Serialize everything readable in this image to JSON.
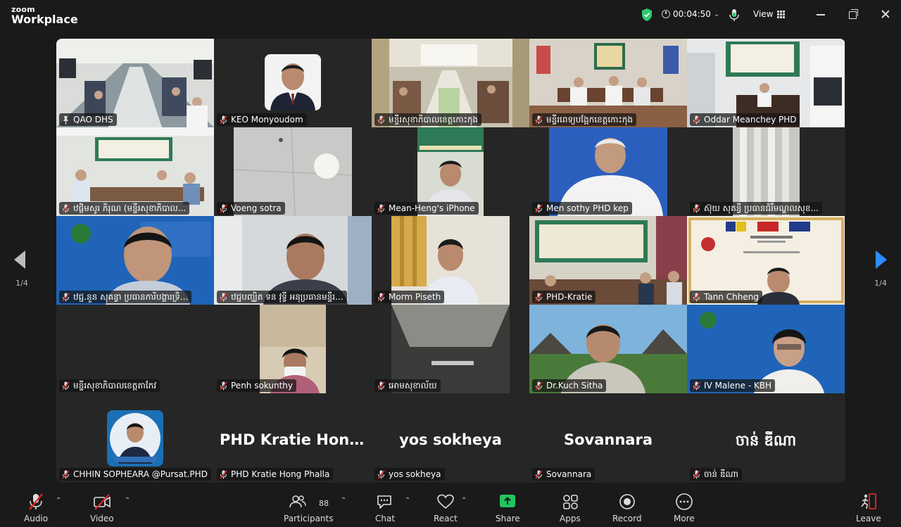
{
  "app": {
    "brand_top": "zoom",
    "brand_bottom": "Workplace"
  },
  "topbar": {
    "timer": "00:04:50",
    "view_label": "View"
  },
  "pagination": {
    "left": "1/4",
    "right": "1/4"
  },
  "tiles": [
    {
      "name": "QAO DHS",
      "icon": "pin-icon"
    },
    {
      "name": "KEO Monyoudom"
    },
    {
      "name": "មន្ទីរសុខាភិបាលខេត្តកោះកុង"
    },
    {
      "name": "មន្ទីរពេទ្យបង្អែកខេត្តកោះកុង"
    },
    {
      "name": "Oddar Meanchey PHD"
    },
    {
      "name": "ឋផ្តិមសូរ ភិរុណ (មន្ទីរសុខាភិបាល..."
    },
    {
      "name": "Voeng sotra"
    },
    {
      "name": "Mean-Heng's iPhone"
    },
    {
      "name": "Men sothy PHD kep"
    },
    {
      "name": "ស៊ុយ សុគន្ធី ប្រធានជំរឹមណ្ឌលសុខ..."
    },
    {
      "name": "ឋជ្ជ.នួន សុគន្ធា ប្រធានការិបង្គារទ្រិ..."
    },
    {
      "name": "ឋជ្ជបញ្ឈិត ទន វុទ្ធី អនុប្រធានមន្ទីរ..."
    },
    {
      "name": "Morm Piseth"
    },
    {
      "name": "PHD-Kratie"
    },
    {
      "name": "Tann Chheng"
    },
    {
      "name": "មន្ទីរសុខាភិបាលខេត្តតាកែវ"
    },
    {
      "name": "Penh sokunthy"
    },
    {
      "name": "អោមសុខាល័យ"
    },
    {
      "name": "Dr.Kuch Sitha"
    },
    {
      "name": "IV Malene - KBH"
    },
    {
      "name": "CHHIN SOPHEARA @Pursat.PHD"
    },
    {
      "name": "PHD Kratie Hong Phalla",
      "display": "PHD Kratie Hon..."
    },
    {
      "name": "yos sokheya",
      "display": "yos sokheya"
    },
    {
      "name": "Sovannara",
      "display": "Sovannara"
    },
    {
      "name": "ចាន់ ឌីណា",
      "display": "ចាន់ ឌីណា"
    }
  ],
  "toolbar": {
    "audio": "Audio",
    "video": "Video",
    "participants": "Participants",
    "participants_count": "88",
    "chat": "Chat",
    "react": "React",
    "share": "Share",
    "apps": "Apps",
    "record": "Record",
    "more": "More",
    "leave": "Leave"
  },
  "colors": {
    "active_border": "#2ec971",
    "share_green": "#22c55e",
    "muted_red": "#e02828",
    "nav_blue": "#2d8cff"
  }
}
